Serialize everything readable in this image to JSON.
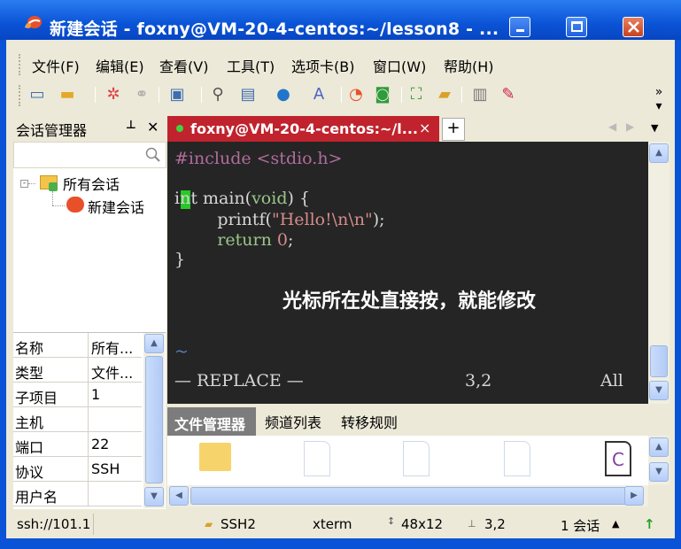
{
  "window": {
    "title": "新建会话 - foxny@VM-20-4-centos:~/lesson8 - ..."
  },
  "menu": [
    "文件(F)",
    "编辑(E)",
    "查看(V)",
    "工具(T)",
    "选项卡(B)",
    "窗口(W)",
    "帮助(H)"
  ],
  "session_manager": {
    "title": "会话管理器",
    "pin": "ᅀ",
    "close": "✕",
    "tree": {
      "root": "所有会话",
      "child": "新建会话"
    },
    "properties": [
      {
        "key": "名称",
        "value": "所有..."
      },
      {
        "key": "类型",
        "value": "文件..."
      },
      {
        "key": "子项目",
        "value": "1"
      },
      {
        "key": "主机",
        "value": ""
      },
      {
        "key": "端口",
        "value": "22"
      },
      {
        "key": "协议",
        "value": "SSH"
      },
      {
        "key": "用户名",
        "value": ""
      }
    ]
  },
  "tab": {
    "label": "foxny@VM-20-4-centos:~/l...",
    "close": "×",
    "new": "+"
  },
  "terminal": {
    "lines": [
      "#include <stdio.h>",
      "",
      "int main(void) {",
      "        printf(\"Hello!\\n\\n\");",
      "        return 0;",
      "}"
    ],
    "tilde": "~",
    "mode": "— REPLACE —",
    "position": "3,2",
    "scroll": "All",
    "annotation": "光标所在处直接按，就能修改"
  },
  "file_panel": {
    "tabs": [
      "文件管理器",
      "频道列表",
      "转移规则"
    ]
  },
  "status": {
    "host": "ssh://101.1",
    "protocol": "SSH2",
    "terminal_type": "xterm",
    "size": "48x12",
    "cursor": "3,2",
    "sessions": "1 会话"
  },
  "colors": {
    "titlebar": "#0a53d6",
    "tab_active": "#c0232d",
    "terminal_bg": "#252525",
    "cursor": "#29c829",
    "keyword_green": "#9ac68a",
    "string_red": "#d68b8b",
    "preprocessor": "#b16c9a"
  }
}
